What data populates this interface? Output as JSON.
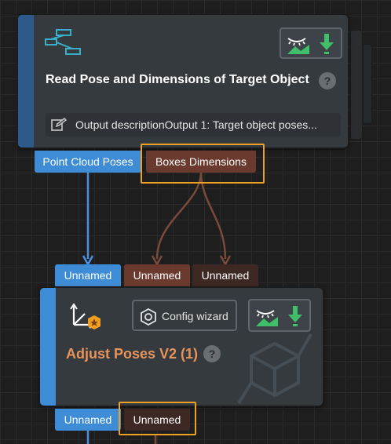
{
  "colors": {
    "accent_blue": "#3f8cd6",
    "port_brown": "#6b3a2e",
    "highlight_orange": "#f0a020",
    "title_orange": "#e8935a",
    "background": "#1e1e1e"
  },
  "node1": {
    "title": "Read Pose and Dimensions of Target Object",
    "help": "?",
    "description": "Output descriptionOutput 1: Target object poses...",
    "icon": "step-graph-icon",
    "status_icons": [
      "visualize-icon",
      "download-icon"
    ],
    "outputs": [
      {
        "label": "Point Cloud Poses",
        "color": "blue"
      },
      {
        "label": "Boxes Dimensions",
        "color": "brown",
        "highlighted": true
      }
    ]
  },
  "node2": {
    "title": "Adjust Poses V2 (1)",
    "help": "?",
    "config_label": "Config wizard",
    "icon": "adjust-poses-icon",
    "status_icons": [
      "visualize-icon",
      "download-icon"
    ],
    "inputs": [
      {
        "label": "Unnamed",
        "color": "blue"
      },
      {
        "label": "Unnamed",
        "color": "brown"
      },
      {
        "label": "Unnamed",
        "color": "dark"
      }
    ],
    "outputs": [
      {
        "label": "Unnamed",
        "color": "blue"
      },
      {
        "label": "Unnamed",
        "color": "dark",
        "highlighted": true
      }
    ]
  }
}
